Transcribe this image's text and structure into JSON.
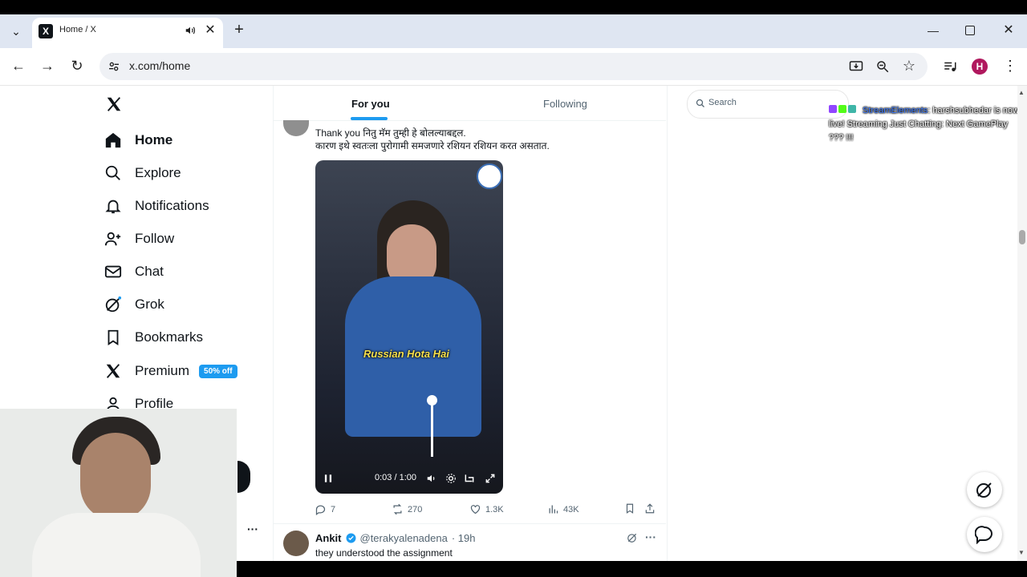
{
  "browser": {
    "tab_title": "Home / X",
    "url": "x.com/home",
    "profile_initial": "H"
  },
  "sidebar": {
    "items": [
      {
        "label": "Home"
      },
      {
        "label": "Explore"
      },
      {
        "label": "Notifications"
      },
      {
        "label": "Follow"
      },
      {
        "label": "Chat"
      },
      {
        "label": "Grok"
      },
      {
        "label": "Bookmarks"
      },
      {
        "label": "Premium"
      },
      {
        "label": "Profile"
      }
    ],
    "premium_badge": "50% off",
    "more_label": "···"
  },
  "feed": {
    "tabs": [
      {
        "label": "For you"
      },
      {
        "label": "Following"
      }
    ],
    "tweet1": {
      "line1": "Thank you नितु मॅम तुम्ही हे बोलल्याबद्दल.",
      "line2": "कारण इथे स्वतःला पुरोगामी समजणारे रशियन रशियन करत असतात.",
      "caption": "Russian Hota Hai",
      "time": "0:03 / 1:00",
      "replies": "7",
      "reposts": "270",
      "likes": "1.3K",
      "views": "43K"
    },
    "tweet2": {
      "name": "Ankit",
      "handle": "@terakyalenadena",
      "age": "· 19h",
      "text": "they understood the assignment"
    }
  },
  "right": {
    "search_placeholder": "Search",
    "stream_source": "StreamElements",
    "stream_message": ": harshsubhedar is now live! Streaming Just Chatting: Next GamePlay ??? !!!"
  },
  "colors": {
    "accent": "#1d9bf0",
    "text": "#0f1419",
    "muted": "#536471"
  }
}
